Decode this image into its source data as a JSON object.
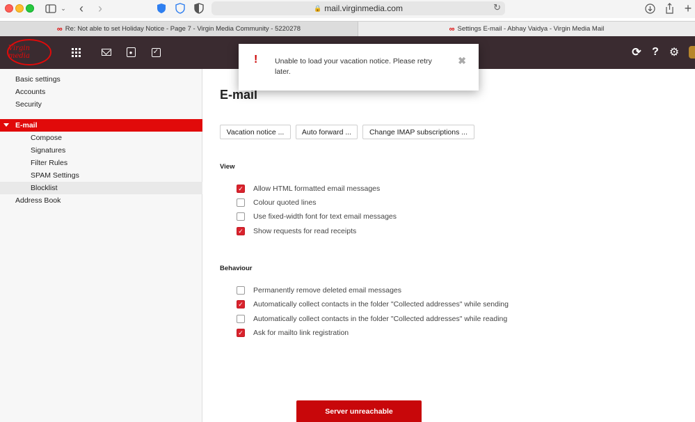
{
  "browser": {
    "url": "mail.virginmedia.com",
    "tabs": [
      {
        "label": "Re: Not able to set Holiday Notice - Page 7 - Virgin Media Community - 5220278"
      },
      {
        "label": "Settings E-mail - Abhay Vaidya - Virgin Media Mail"
      }
    ]
  },
  "app": {
    "logo_text": "Virgin media",
    "nav_icons": [
      "apps-grid-icon",
      "mail-icon",
      "contacts-icon",
      "tasks-icon"
    ],
    "right_icons": [
      "refresh-icon",
      "help-icon",
      "settings-gear-icon"
    ]
  },
  "sidebar": {
    "items": [
      {
        "label": "Basic settings"
      },
      {
        "label": "Accounts"
      },
      {
        "label": "Security"
      },
      {
        "label": "E-mail"
      },
      {
        "label": "Compose"
      },
      {
        "label": "Signatures"
      },
      {
        "label": "Filter Rules"
      },
      {
        "label": "SPAM Settings"
      },
      {
        "label": "Blocklist"
      },
      {
        "label": "Address Book"
      }
    ]
  },
  "main": {
    "title": "E-mail",
    "buttons": {
      "vacation": "Vacation notice ...",
      "forward": "Auto forward ...",
      "imap": "Change IMAP subscriptions ..."
    },
    "view": {
      "heading": "View",
      "options": [
        {
          "label": "Allow HTML formatted email messages",
          "checked": true
        },
        {
          "label": "Colour quoted lines",
          "checked": false
        },
        {
          "label": "Use fixed-width font for text email messages",
          "checked": false
        },
        {
          "label": "Show requests for read receipts",
          "checked": true
        }
      ]
    },
    "behaviour": {
      "heading": "Behaviour",
      "options": [
        {
          "label": "Permanently remove deleted email messages",
          "checked": false
        },
        {
          "label": "Automatically collect contacts in the folder \"Collected addresses\" while sending",
          "checked": true
        },
        {
          "label": "Automatically collect contacts in the folder \"Collected addresses\" while reading",
          "checked": false
        },
        {
          "label": "Ask for mailto link registration",
          "checked": true
        }
      ]
    }
  },
  "notification": {
    "message": "Unable to load your vacation notice. Please retry later.",
    "close": "✖"
  },
  "status": {
    "server": "Server unreachable"
  },
  "colors": {
    "brand_red": "#e10a0a",
    "header_bg": "#3a2b30"
  }
}
